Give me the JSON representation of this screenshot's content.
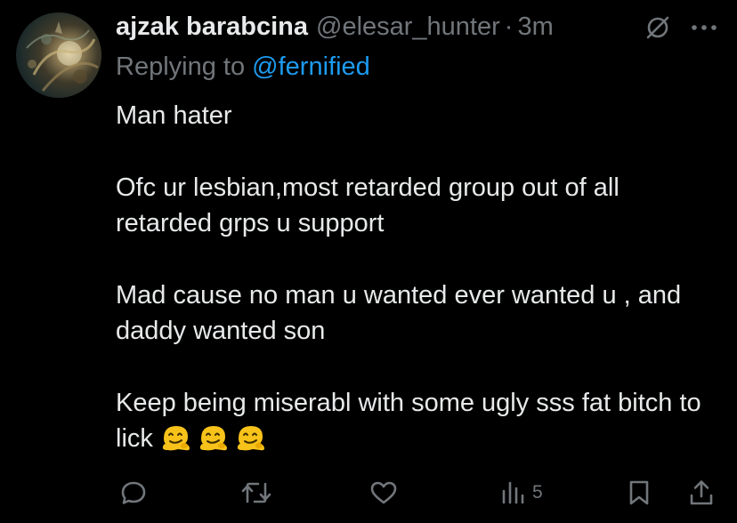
{
  "tweet": {
    "author": {
      "display_name": "ajzak barabcina",
      "handle": "@elesar_hunter",
      "separator": "·",
      "time": "3m"
    },
    "reply": {
      "prefix": "Replying to ",
      "target": "@fernified"
    },
    "paragraphs": [
      "Man hater",
      "Ofc ur lesbian,most retarded group out of all retarded grps u support",
      "Mad cause no man u wanted ever wanted u , and daddy wanted son",
      "Keep being miserabl with some ugly sss fat bitch to lick"
    ],
    "emoji": [
      "melting-face-emoji",
      "melting-face-emoji",
      "melting-face-emoji"
    ],
    "actions": {
      "reply_icon": "reply-icon",
      "retweet_icon": "retweet-icon",
      "like_icon": "like-icon",
      "views_icon": "views-icon",
      "views_count": "5",
      "bookmark_icon": "bookmark-icon",
      "share_icon": "share-icon"
    }
  },
  "colors": {
    "background": "#000000",
    "text": "#e7e9ea",
    "muted": "#71767b",
    "link": "#1d9bf0",
    "emoji": "#f7c21a"
  }
}
